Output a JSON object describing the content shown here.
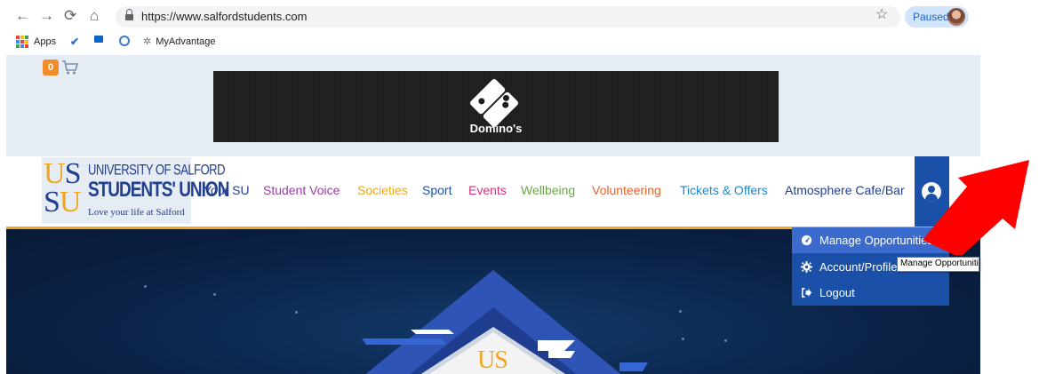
{
  "browser": {
    "url": "https://www.salfordstudents.com",
    "profile_status": "Paused",
    "bookmarks": [
      {
        "label": "Apps"
      },
      {
        "label": ""
      },
      {
        "label": ""
      },
      {
        "label": ""
      },
      {
        "label": "MyAdvantage"
      }
    ]
  },
  "header": {
    "cart_count": "0",
    "banner_text": "Domino's"
  },
  "logo": {
    "letters_top": [
      "U",
      "S"
    ],
    "letters_bottom": [
      "S",
      "U"
    ],
    "line1": "UNIVERSITY OF SALFORD",
    "line2": "STUDENTS' UNION",
    "tagline": "Love your life at Salford"
  },
  "nav": [
    {
      "label": "Your SU",
      "color": "#23408e"
    },
    {
      "label": "Student Voice",
      "color": "#9b3fa6"
    },
    {
      "label": "Societies",
      "color": "#f0a71c"
    },
    {
      "label": "Sport",
      "color": "#1a50a8"
    },
    {
      "label": "Events",
      "color": "#d0337a"
    },
    {
      "label": "Wellbeing",
      "color": "#6aa843"
    },
    {
      "label": "Volunteering",
      "color": "#e8632a"
    },
    {
      "label": "Tickets & Offers",
      "color": "#1e88c8"
    },
    {
      "label": "Atmosphere Cafe/Bar",
      "color": "#23408e"
    }
  ],
  "dropdown": {
    "items": [
      {
        "label": "Manage Opportunities",
        "icon": "dashboard-icon"
      },
      {
        "label": "Account/Profile",
        "icon": "cog-icon"
      },
      {
        "label": "Logout",
        "icon": "sign-out-icon"
      }
    ],
    "tooltip": "Manage Opportunities"
  },
  "hero": {
    "emblem_text": "US"
  },
  "colors": {
    "brand_blue": "#1a50a8",
    "gold": "#f0a71c",
    "annotation_arrow": "#ff0000"
  }
}
